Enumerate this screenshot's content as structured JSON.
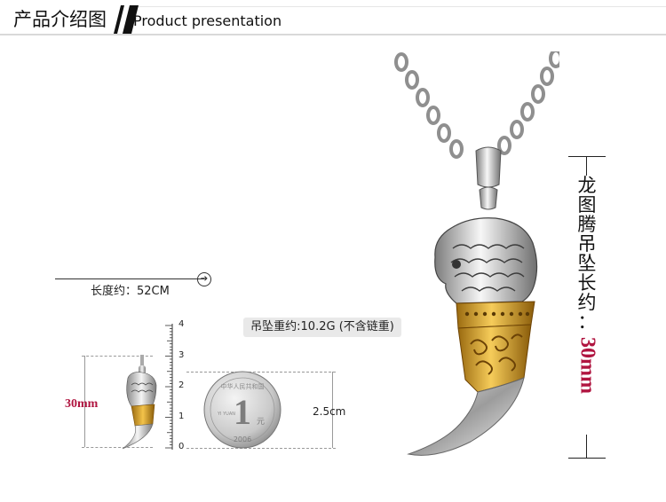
{
  "header": {
    "title_cn": "产品介绍图",
    "title_en": "Product presentation"
  },
  "chain": {
    "length_label": "长度约：52CM",
    "arrow_icon": "arrow-right-icon"
  },
  "weight": {
    "label": "吊坠重约:10.2G (不含链重)"
  },
  "small_pendant": {
    "height_label": "30mm"
  },
  "ruler": {
    "ticks": [
      "4",
      "3",
      "2",
      "1",
      "0"
    ]
  },
  "coin": {
    "diameter_label": "2.5cm",
    "face_value": "1",
    "unit": "元",
    "year": "2006",
    "ring_text": "中华人民共和国",
    "pinyin": "YI YUAN"
  },
  "big_pendant": {
    "length_label_cn": "龙图腾吊坠长约：",
    "length_value": "30mm"
  },
  "colors": {
    "accent": "#b01540",
    "gold": "#d9a02a",
    "silver": "#c8c8c8"
  }
}
